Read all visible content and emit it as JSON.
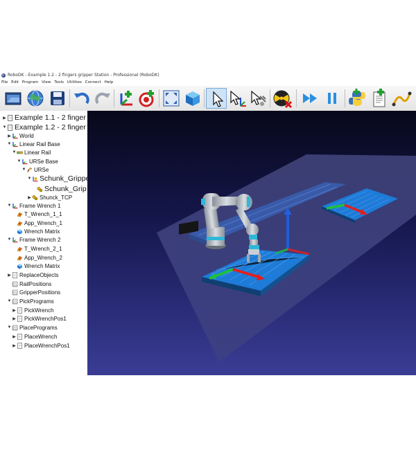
{
  "window": {
    "title": "RoboDK - Example 1.2 - 2 fingers gripper Station - Professional (RoboDK)"
  },
  "menu": [
    "File",
    "Edit",
    "Program",
    "View",
    "Tools",
    "Utilities",
    "Connect",
    "Help"
  ],
  "toolbar": {
    "buttons": [
      {
        "name": "open-icon"
      },
      {
        "name": "library-globe-icon"
      },
      {
        "name": "save-icon"
      },
      {
        "name": "undo-icon"
      },
      {
        "name": "redo-icon"
      },
      {
        "name": "add-reference-frame-icon"
      },
      {
        "name": "add-target-icon"
      },
      {
        "name": "fit-all-icon"
      },
      {
        "name": "iso-view-icon"
      },
      {
        "name": "select-cursor-icon"
      },
      {
        "name": "move-reference-icon"
      },
      {
        "name": "move-tool-icon"
      },
      {
        "name": "collision-check-icon"
      },
      {
        "name": "fast-simulation-icon"
      },
      {
        "name": "pause-icon"
      },
      {
        "name": "python-icon"
      },
      {
        "name": "add-program-icon"
      },
      {
        "name": "path-icon"
      }
    ],
    "active": "select-cursor-icon"
  },
  "tree": [
    {
      "label": "Example 1.1 - 2 finger",
      "level": 0,
      "icon": "station-icon",
      "arrow": "right",
      "big": true
    },
    {
      "label": "Example 1.2 - 2 finger",
      "level": 0,
      "icon": "station-icon",
      "arrow": "down",
      "big": true
    },
    {
      "label": "World",
      "level": 1,
      "icon": "frame-icon",
      "arrow": "right"
    },
    {
      "label": "Linear Rail Base",
      "level": 1,
      "icon": "frame-icon",
      "arrow": "down"
    },
    {
      "label": "Linear Rail",
      "level": 2,
      "icon": "rail-icon",
      "arrow": "down"
    },
    {
      "label": "URSe Base",
      "level": 3,
      "icon": "frame-icon",
      "arrow": "down"
    },
    {
      "label": "URSe",
      "level": 4,
      "icon": "robot-icon",
      "arrow": "down"
    },
    {
      "label": "Schunk_Grippе",
      "level": 5,
      "icon": "tool-frame-icon",
      "arrow": "down",
      "big": true
    },
    {
      "label": "Schunk_Grip",
      "level": 6,
      "icon": "gripper-icon",
      "arrow": "none",
      "big": true
    },
    {
      "label": "Shunck_TCP",
      "level": 5,
      "icon": "gripper-icon",
      "arrow": "right"
    },
    {
      "label": "Frame Wrench 1",
      "level": 1,
      "icon": "frame-icon",
      "arrow": "down"
    },
    {
      "label": "T_Wrench_1_1",
      "level": 2,
      "icon": "target-icon",
      "arrow": "none"
    },
    {
      "label": "App_Wrench_1",
      "level": 2,
      "icon": "target-icon",
      "arrow": "none"
    },
    {
      "label": "Wrench Matrix",
      "level": 2,
      "icon": "object-icon",
      "arrow": "none"
    },
    {
      "label": "Frame Wrench 2",
      "level": 1,
      "icon": "frame-icon",
      "arrow": "down"
    },
    {
      "label": "T_Wrench_2_1",
      "level": 2,
      "icon": "target-icon",
      "arrow": "none"
    },
    {
      "label": "App_Wrench_2",
      "level": 2,
      "icon": "target-icon",
      "arrow": "none"
    },
    {
      "label": "Wrench Matrix",
      "level": 2,
      "icon": "object-icon",
      "arrow": "none"
    },
    {
      "label": "ReplaceObjects",
      "level": 1,
      "icon": "program-icon",
      "arrow": "right"
    },
    {
      "label": "RailPositions",
      "level": 1,
      "icon": "folder-icon",
      "arrow": "none"
    },
    {
      "label": "GripperPositions",
      "level": 1,
      "icon": "folder-icon",
      "arrow": "none"
    },
    {
      "label": "PickPrograms",
      "level": 1,
      "icon": "folder-icon",
      "arrow": "down"
    },
    {
      "label": "PickWrench",
      "level": 2,
      "icon": "program-icon",
      "arrow": "right"
    },
    {
      "label": "PickWrenchPos1",
      "level": 2,
      "icon": "program-icon",
      "arrow": "right"
    },
    {
      "label": "PlacePrograms",
      "level": 1,
      "icon": "folder-icon",
      "arrow": "down"
    },
    {
      "label": "PlaceWrench",
      "level": 2,
      "icon": "program-icon",
      "arrow": "right"
    },
    {
      "label": "PlaceWrenchPos1",
      "level": 2,
      "icon": "program-icon",
      "arrow": "right"
    }
  ],
  "colors": {
    "background": "#ffffff",
    "viewport_top": "#08081a",
    "viewport_bottom": "#3a3d94",
    "table_blue": "#1e7bd8",
    "robot_cyan": "#2fb7d8",
    "axis_x": "#e02020",
    "axis_y": "#20c040",
    "axis_z": "#2060e0"
  }
}
